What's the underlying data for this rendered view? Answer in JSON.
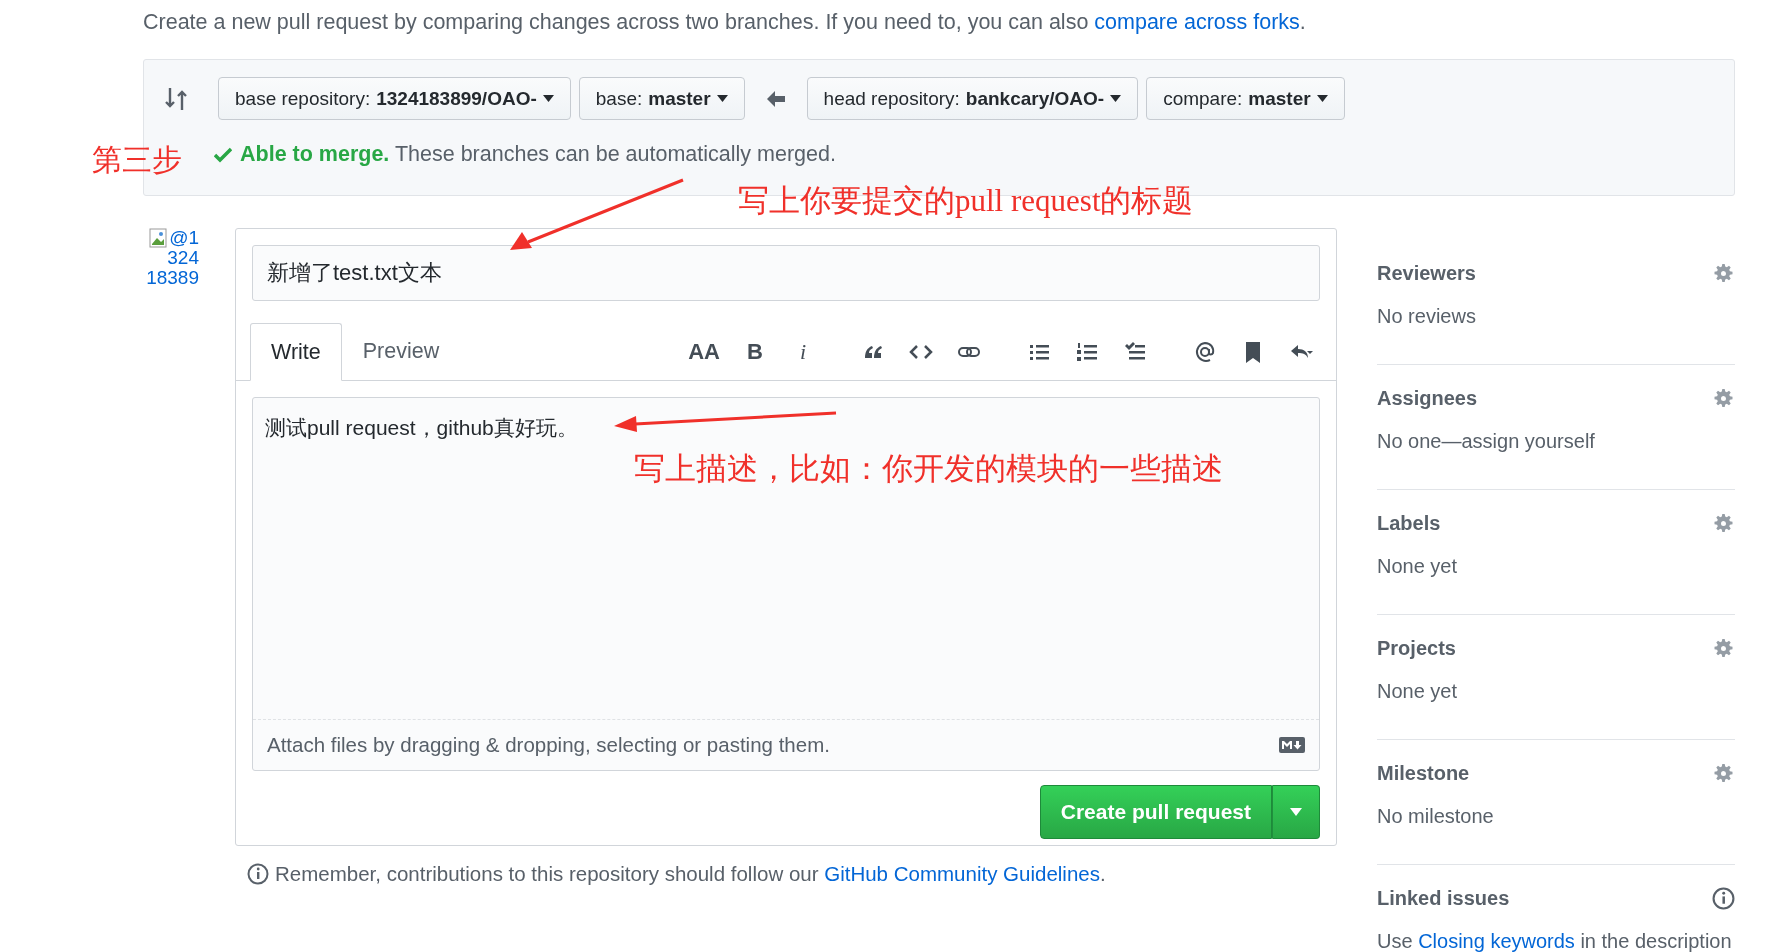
{
  "intro": {
    "text": "Create a new pull request by comparing changes across two branches. If you need to, you can also ",
    "link": "compare across forks",
    "end": "."
  },
  "compare": {
    "branches": [
      {
        "label": "base repository:",
        "value": "1324183899/OAO-"
      },
      {
        "label": "base:",
        "value": "master"
      },
      {
        "label": "head repository:",
        "value": "bankcary/OAO-"
      },
      {
        "label": "compare:",
        "value": "master"
      }
    ],
    "merge_status": {
      "title": "Able to merge.",
      "text": "These branches can be automatically merged."
    }
  },
  "avatar": {
    "alt_lines": [
      "@1",
      "324",
      "18389"
    ]
  },
  "form": {
    "title_value": "新增了test.txt文本",
    "tabs": [
      {
        "label": "Write",
        "selected": true
      },
      {
        "label": "Preview",
        "selected": false
      }
    ],
    "toolbar": [
      {
        "kind": "heading",
        "glyph": "AA"
      },
      {
        "kind": "bold",
        "glyph": "B"
      },
      {
        "kind": "italic",
        "glyph": "i"
      },
      {
        "kind": "quote"
      },
      {
        "kind": "code"
      },
      {
        "kind": "link"
      },
      {
        "kind": "bullet-list"
      },
      {
        "kind": "numbered-list"
      },
      {
        "kind": "task-list"
      },
      {
        "kind": "mention"
      },
      {
        "kind": "bookmark"
      },
      {
        "kind": "reply"
      }
    ],
    "body_value": "测试pull request，github真好玩。",
    "attach_hint": "Attach files by dragging & dropping, selecting or pasting them.",
    "submit": "Create pull request"
  },
  "guidelines": {
    "text": "Remember, contributions to this repository should follow our ",
    "link": "GitHub Community Guidelines",
    "end": "."
  },
  "sidebar": [
    {
      "kind": "gear",
      "title": "Reviewers",
      "value": "No reviews"
    },
    {
      "kind": "gear",
      "title": "Assignees",
      "value": "No one—assign yourself"
    },
    {
      "kind": "gear",
      "title": "Labels",
      "value": "None yet"
    },
    {
      "kind": "gear",
      "title": "Projects",
      "value": "None yet"
    },
    {
      "kind": "gear",
      "title": "Milestone",
      "value": "No milestone"
    },
    {
      "kind": "info",
      "title": "Linked issues",
      "before": "Use ",
      "link": "Closing keywords",
      "after": " in the description"
    }
  ],
  "annotations": [
    {
      "kind": "step",
      "text": "第三步"
    },
    {
      "kind": "title-note",
      "text": "写上你要提交的pull request的标题"
    },
    {
      "kind": "body-note",
      "text": "写上描述，比如：你开发的模块的一些描述"
    }
  ]
}
